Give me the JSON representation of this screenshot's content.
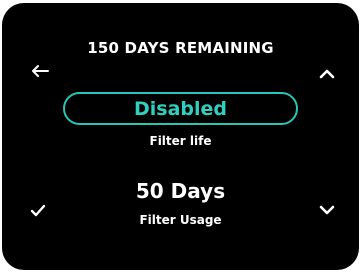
{
  "status": {
    "remaining": "150 DAYS REMAINING"
  },
  "items": [
    {
      "value": "Disabled",
      "label": "Filter life",
      "selected": true
    },
    {
      "value": "50 Days",
      "label": "Filter Usage",
      "selected": false
    }
  ],
  "icons": {
    "back": "arrow-left-icon",
    "up": "chevron-up-icon",
    "confirm": "check-icon",
    "down": "chevron-down-icon"
  },
  "colors": {
    "background": "#000000",
    "accent": "#25c7b5",
    "text": "#ffffff"
  }
}
